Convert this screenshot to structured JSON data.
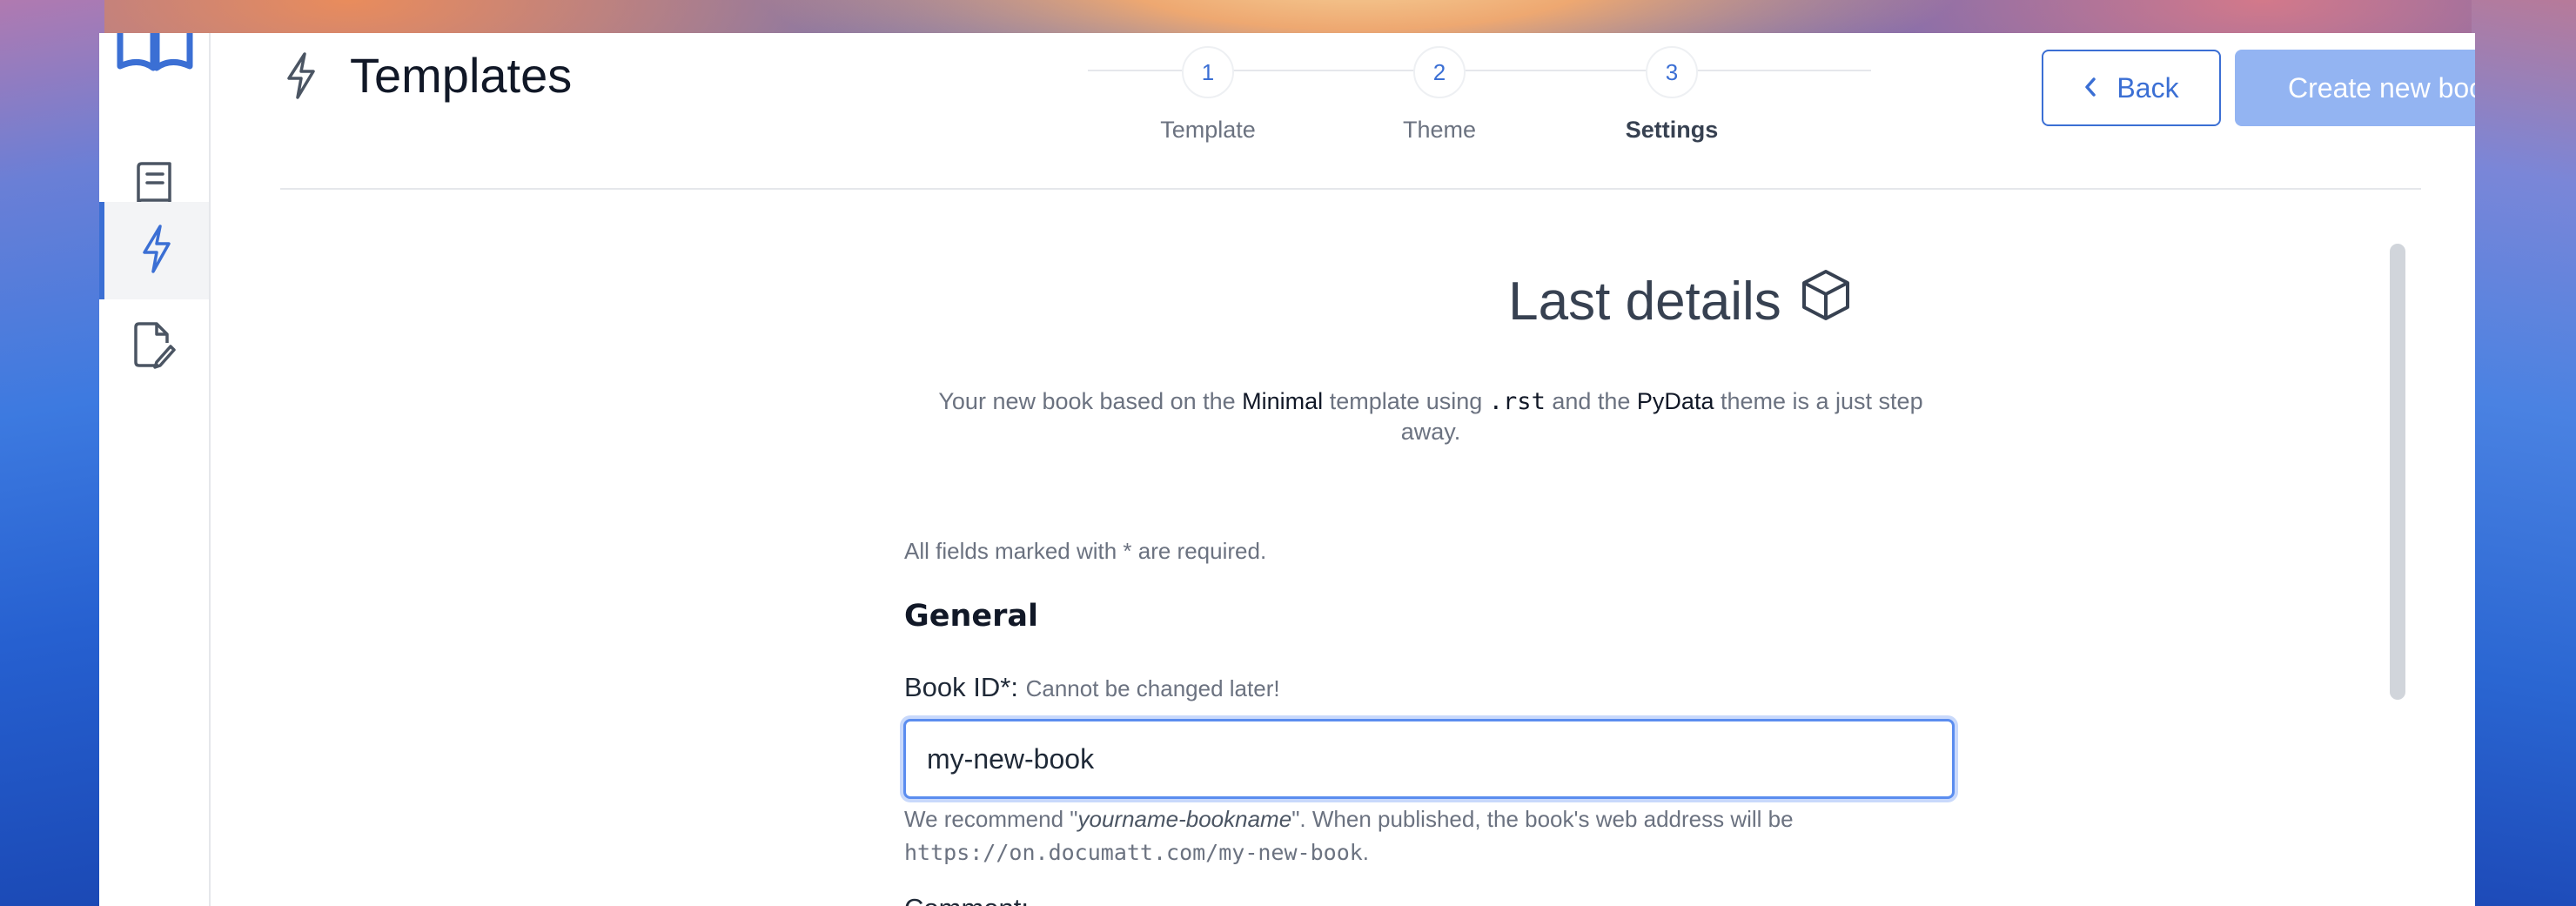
{
  "header": {
    "title": "Templates",
    "back_label": "Back",
    "create_label": "Create new book"
  },
  "stepper": {
    "steps": [
      {
        "number": "1",
        "label": "Template"
      },
      {
        "number": "2",
        "label": "Theme"
      },
      {
        "number": "3",
        "label": "Settings"
      }
    ],
    "current": 3
  },
  "sidebar": {
    "items": [
      {
        "icon": "book-icon",
        "active": false
      },
      {
        "icon": "lightning-icon",
        "active": true
      },
      {
        "icon": "document-edit-icon",
        "active": false
      }
    ]
  },
  "main": {
    "title": "Last details",
    "title_icon": "cube-icon",
    "subtitle_part1": "Your new book based on the ",
    "subtitle_template": "Minimal",
    "subtitle_part2": " template using ",
    "subtitle_format": ".rst",
    "subtitle_part3": " and the ",
    "subtitle_theme": "PyData",
    "subtitle_part4": " theme is a just step away.",
    "required_note": "All fields marked with * are required.",
    "group_title": "General",
    "book_id_label": "Book ID*:",
    "book_id_hint": "Cannot be changed later!",
    "book_id_value": "my-new-book",
    "help_part1": "We recommend \"",
    "help_example": "yourname-bookname",
    "help_part2": "\". When published, the book's web address will be ",
    "help_url": "https://on.documatt.com/my-new-book",
    "help_part3": ".",
    "comment_label": "Comment:"
  },
  "colors": {
    "accent": "#3b6fd4",
    "create_button": "#93b4f2",
    "focus_ring": "#c9d9fb"
  }
}
